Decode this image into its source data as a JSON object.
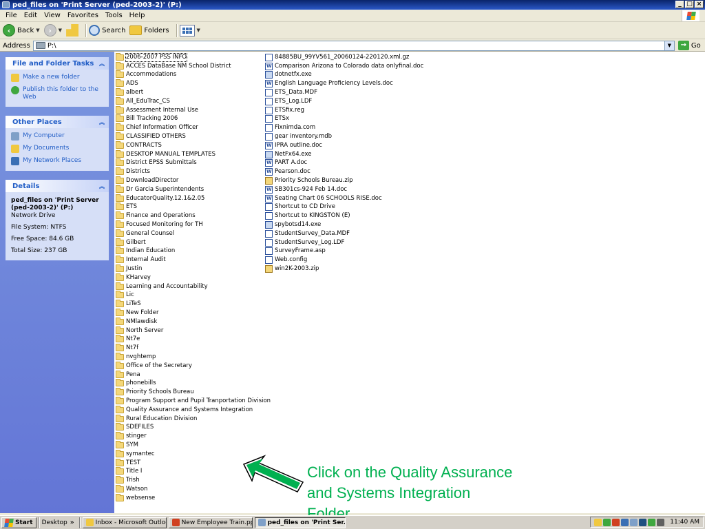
{
  "window": {
    "title": "ped_files on 'Print Server (ped-2003-2)' (P:)"
  },
  "menu": [
    "File",
    "Edit",
    "View",
    "Favorites",
    "Tools",
    "Help"
  ],
  "toolbar": {
    "back_label": "Back",
    "search_label": "Search",
    "folders_label": "Folders"
  },
  "address": {
    "label": "Address",
    "path": "P:\\",
    "go_label": "Go"
  },
  "tasks": {
    "file_folder_title": "File and Folder Tasks",
    "file_folder_items": [
      "Make a new folder",
      "Publish this folder to the Web"
    ],
    "other_places_title": "Other Places",
    "other_places_items": [
      "My Computer",
      "My Documents",
      "My Network Places"
    ],
    "details_title": "Details",
    "details_name": "ped_files on 'Print Server (ped-2003-2)' (P:)",
    "details_type": "Network Drive",
    "details_fs": "File System: NTFS",
    "details_free": "Free Space: 84.6 GB",
    "details_total": "Total Size: 237 GB"
  },
  "folders": [
    "2006-2007 PSS INFO",
    "ACCES DataBase NM School District",
    "Accommodations",
    "ADS",
    "albert",
    "All_EduTrac_CS",
    "Assessment Internal Use",
    "Bill Tracking 2006",
    "Chief Information Officer",
    "CLASSIFIED OTHERS",
    "CONTRACTS",
    "DESKTOP MANUAL TEMPLATES",
    "District EPSS Submittals",
    "Districts",
    "DownloadDirector",
    "Dr Garcia Superintendents",
    "EducatorQuality.12.1&2.05",
    "ETS",
    "Finance and Operations",
    "Focused Monitoring for TH",
    "General Counsel",
    "Gilbert",
    "Indian Education",
    "Internal Audit",
    "Justin",
    "KHarvey",
    "Learning and Accountability",
    "Lic",
    "LiTeS",
    "New Folder",
    "NMlawdisk",
    "North Server",
    "Nt7e",
    "Nt7f",
    "nvghtemp",
    "Office of the Secretary",
    "Pena",
    "phonebills",
    "Priority Schools Bureau",
    "Program Support and Pupil Tranportation Division",
    "Quality Assurance and Systems Integration",
    "Rural Education Division",
    "SDEFILES",
    "stinger",
    "SYM",
    "symantec",
    "TEST",
    "Title I",
    "Trish",
    "Watson",
    "websense"
  ],
  "files": [
    {
      "name": "84885BU_99YV561_20060124-220120.xml.gz",
      "icon": "file-icon"
    },
    {
      "name": "Comparison Arizona to Colorado data onlyfinal.doc",
      "icon": "doc-icon"
    },
    {
      "name": "dotnetfx.exe",
      "icon": "exe-icon"
    },
    {
      "name": "English Language Proficiency Levels.doc",
      "icon": "doc-icon"
    },
    {
      "name": "ETS_Data.MDF",
      "icon": "file-icon"
    },
    {
      "name": "ETS_Log.LDF",
      "icon": "file-icon"
    },
    {
      "name": "ETSfix.reg",
      "icon": "reg-icon"
    },
    {
      "name": "ETSx",
      "icon": "file-icon"
    },
    {
      "name": "Fixnimda.com",
      "icon": "file-icon"
    },
    {
      "name": "gear inventory.mdb",
      "icon": "file-icon"
    },
    {
      "name": "IPRA outline.doc",
      "icon": "doc-icon"
    },
    {
      "name": "NetFx64.exe",
      "icon": "exe-icon"
    },
    {
      "name": "PART A.doc",
      "icon": "doc-icon"
    },
    {
      "name": "Pearson.doc",
      "icon": "doc-icon"
    },
    {
      "name": "Priority Schools Bureau.zip",
      "icon": "zip-icon"
    },
    {
      "name": "SB301cs-924 Feb 14.doc",
      "icon": "doc-icon"
    },
    {
      "name": "Seating Chart 06 SCHOOLS RISE.doc",
      "icon": "doc-icon"
    },
    {
      "name": "Shortcut to CD Drive",
      "icon": "shortcut-icon"
    },
    {
      "name": "Shortcut to KINGSTON (E)",
      "icon": "shortcut-icon"
    },
    {
      "name": "spybotsd14.exe",
      "icon": "exe-icon"
    },
    {
      "name": "StudentSurvey_Data.MDF",
      "icon": "file-icon"
    },
    {
      "name": "StudentSurvey_Log.LDF",
      "icon": "file-icon"
    },
    {
      "name": "SurveyFrame.asp",
      "icon": "file-icon"
    },
    {
      "name": "Web.config",
      "icon": "file-icon"
    },
    {
      "name": "win2K-2003.zip",
      "icon": "zip-icon"
    }
  ],
  "annotation": {
    "text": "Click on the Quality Assurance and Systems Integration Folder",
    "color": "#00b050"
  },
  "taskbar": {
    "start_label": "Start",
    "desktop_label": "Desktop",
    "tasks": [
      "Inbox - Microsoft Outlook",
      "New Employee Train.ppt",
      "ped_files on 'Print Ser..."
    ],
    "clock": "11:40 AM"
  }
}
